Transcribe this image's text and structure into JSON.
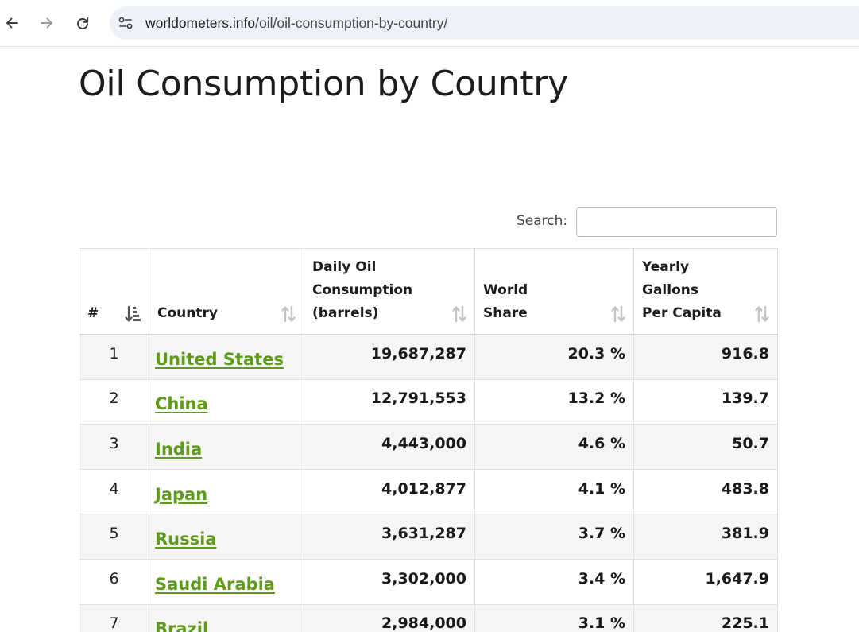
{
  "browser": {
    "url_host": "worldometers.info",
    "url_path": "/oil/oil-consumption-by-country/"
  },
  "page": {
    "title": "Oil Consumption by Country",
    "search_label": "Search:",
    "search_value": ""
  },
  "table": {
    "headers": {
      "rank": "#",
      "country": "Country",
      "daily": [
        "Daily Oil",
        "Consumption",
        "(barrels)"
      ],
      "share": [
        "World",
        "Share"
      ],
      "gallons": [
        "Yearly Gallons",
        "Per Capita"
      ]
    },
    "rows": [
      {
        "rank": "1",
        "country": "United States",
        "daily": "19,687,287",
        "share": "20.3 %",
        "gallons": "916.8"
      },
      {
        "rank": "2",
        "country": "China",
        "daily": "12,791,553",
        "share": "13.2 %",
        "gallons": "139.7"
      },
      {
        "rank": "3",
        "country": "India",
        "daily": "4,443,000",
        "share": "4.6 %",
        "gallons": "50.7"
      },
      {
        "rank": "4",
        "country": "Japan",
        "daily": "4,012,877",
        "share": "4.1 %",
        "gallons": "483.8"
      },
      {
        "rank": "5",
        "country": "Russia",
        "daily": "3,631,287",
        "share": "3.7 %",
        "gallons": "381.9"
      },
      {
        "rank": "6",
        "country": "Saudi Arabia",
        "daily": "3,302,000",
        "share": "3.4 %",
        "gallons": "1,647.9"
      },
      {
        "rank": "7",
        "country": "Brazil",
        "daily": "2,984,000",
        "share": "3.1 %",
        "gallons": "225.1"
      }
    ]
  },
  "colors": {
    "link_green": "#5e9b1a",
    "row_stripe": "#f5f5f5",
    "sort_icon": "#c4c4c4",
    "sort_icon_active": "#555555"
  }
}
